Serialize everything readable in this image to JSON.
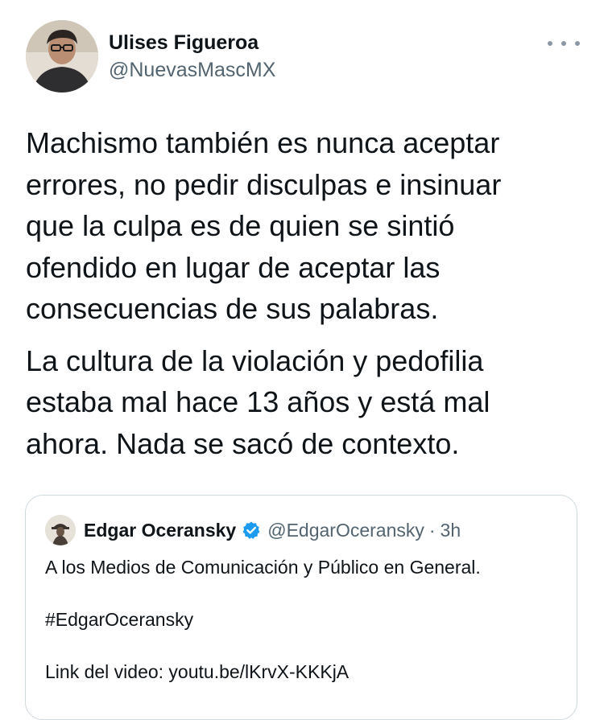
{
  "tweet": {
    "author": {
      "name": "Ulises Figueroa",
      "handle": "@NuevasMascMX",
      "avatar_icon": "person-avatar"
    },
    "more_icon": "more-horizontal-icon",
    "paragraph1_lines": [
      "Machismo también es nunca aceptar",
      "errores, no pedir disculpas e insinuar",
      "que la culpa es de quien se sintió",
      "ofendido en lugar de aceptar las",
      "consecuencias de sus palabras."
    ],
    "paragraph2_lines": [
      "La cultura de la violación y pedofilia",
      "estaba mal hace 13 años y está mal",
      "ahora. Nada se sacó de contexto."
    ]
  },
  "quoted_tweet": {
    "author": {
      "name": "Edgar Oceransky",
      "handle": "@EdgarOceransky",
      "separator": "·",
      "time": "3h",
      "verified_icon": "verified-badge-icon",
      "avatar_icon": "person-avatar"
    },
    "lines": [
      "A los Medios de Comunicación y Público en General.",
      "#EdgarOceransky",
      "Link del video: youtu.be/lKrvX-KKKjA"
    ]
  },
  "colors": {
    "text": "#0f1419",
    "secondary": "#536471",
    "border": "#cfd9de",
    "verified": "#1d9bf0"
  }
}
